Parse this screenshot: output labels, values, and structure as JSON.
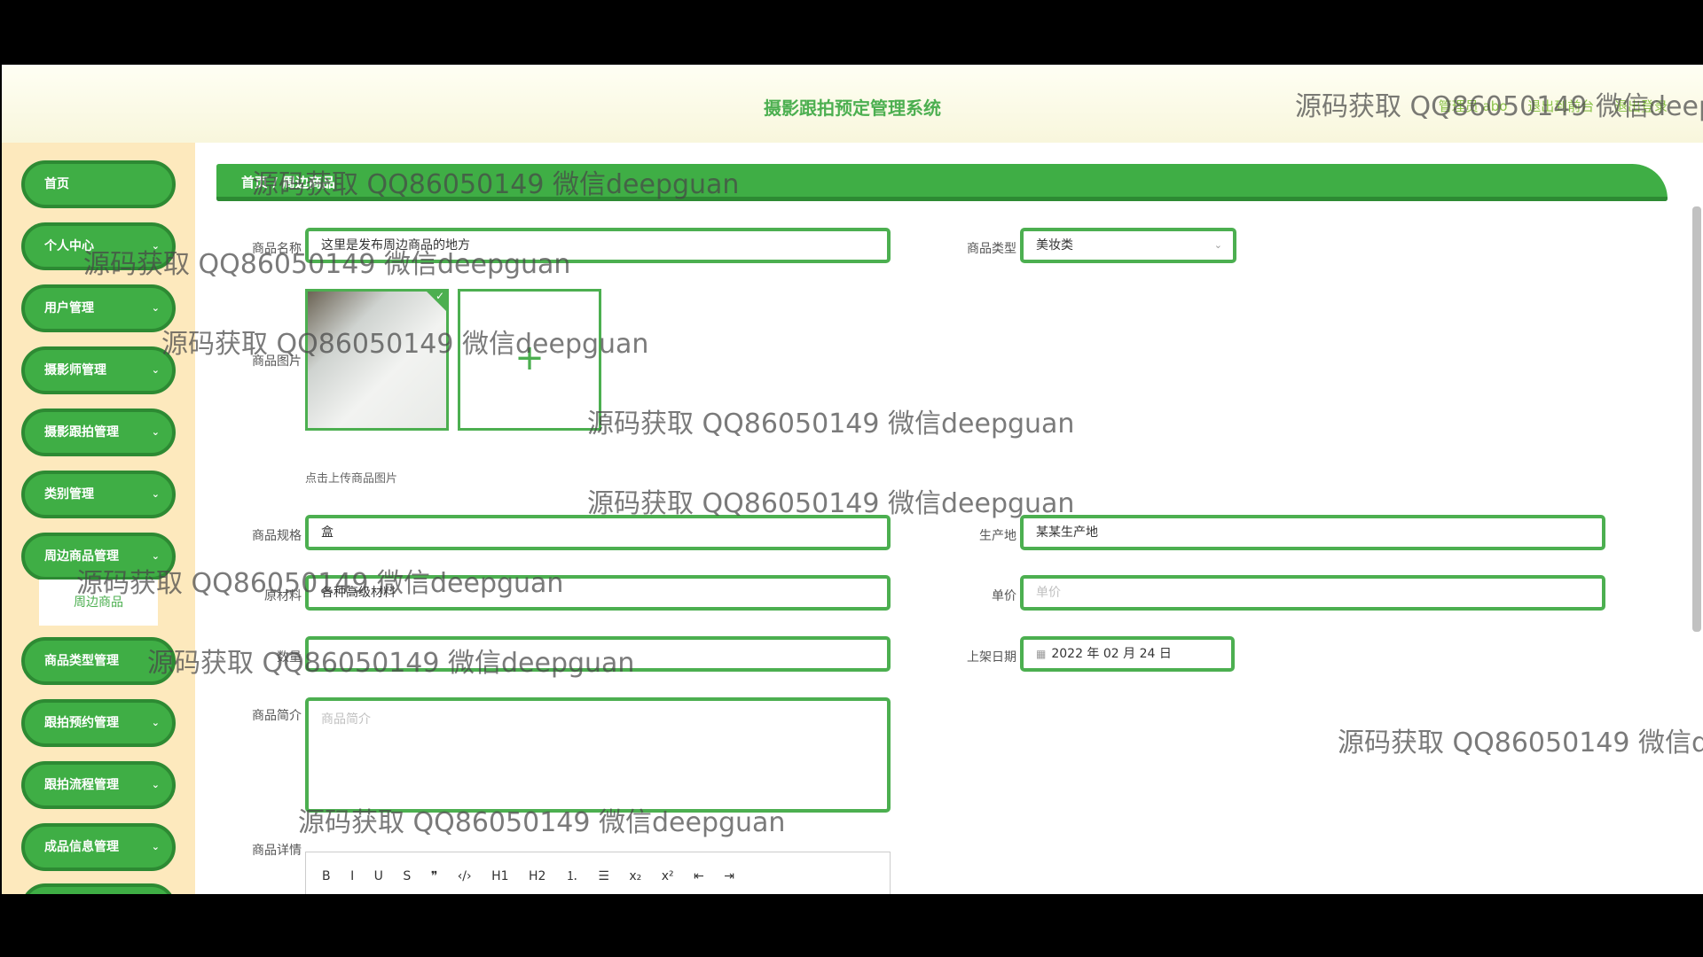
{
  "header": {
    "title": "摄影跟拍预定管理系统",
    "links": [
      "管理员 abo",
      "退出到前台",
      "退出登录"
    ]
  },
  "sidebar": {
    "items": [
      {
        "label": "首页",
        "expandable": false
      },
      {
        "label": "个人中心",
        "expandable": true
      },
      {
        "label": "用户管理",
        "expandable": true
      },
      {
        "label": "摄影师管理",
        "expandable": true
      },
      {
        "label": "摄影跟拍管理",
        "expandable": true
      },
      {
        "label": "类别管理",
        "expandable": true
      },
      {
        "label": "周边商品管理",
        "expandable": true
      },
      {
        "label": "商品类型管理",
        "expandable": true
      },
      {
        "label": "跟拍预约管理",
        "expandable": true
      },
      {
        "label": "跟拍流程管理",
        "expandable": true
      },
      {
        "label": "成品信息管理",
        "expandable": true
      }
    ],
    "sub_item": "周边商品",
    "chevron": "⌄"
  },
  "breadcrumb": "首页 / 周边商品",
  "form": {
    "name_label": "商品名称",
    "name_value": "这里是发布周边商品的地方",
    "type_label": "商品类型",
    "type_value": "美妆类",
    "select_arrow": "⌄",
    "image_label": "商品图片",
    "upload_plus": "+",
    "upload_tip": "点击上传商品图片",
    "check": "✓",
    "spec_label": "商品规格",
    "spec_value": "盒",
    "origin_label": "生产地",
    "origin_value": "某某生产地",
    "material_label": "原材料",
    "material_value": "各种高级材料",
    "price_label": "单价",
    "price_placeholder": "单价",
    "qty_label": "数量",
    "qty_placeholder": "",
    "date_label": "上架日期",
    "date_value": "2022 年 02 月 24 日",
    "calendar_icon": "▦",
    "intro_label": "商品简介",
    "intro_placeholder": "商品简介",
    "detail_label": "商品详情",
    "editor_tools": [
      "B",
      "I",
      "U",
      "S",
      "❞",
      "‹/›",
      "H1",
      "H2",
      "⒈",
      "☰",
      "x₂",
      "x²",
      "⇤",
      "⇥"
    ]
  },
  "watermark": "源码获取 QQ86050149 微信deepguan"
}
